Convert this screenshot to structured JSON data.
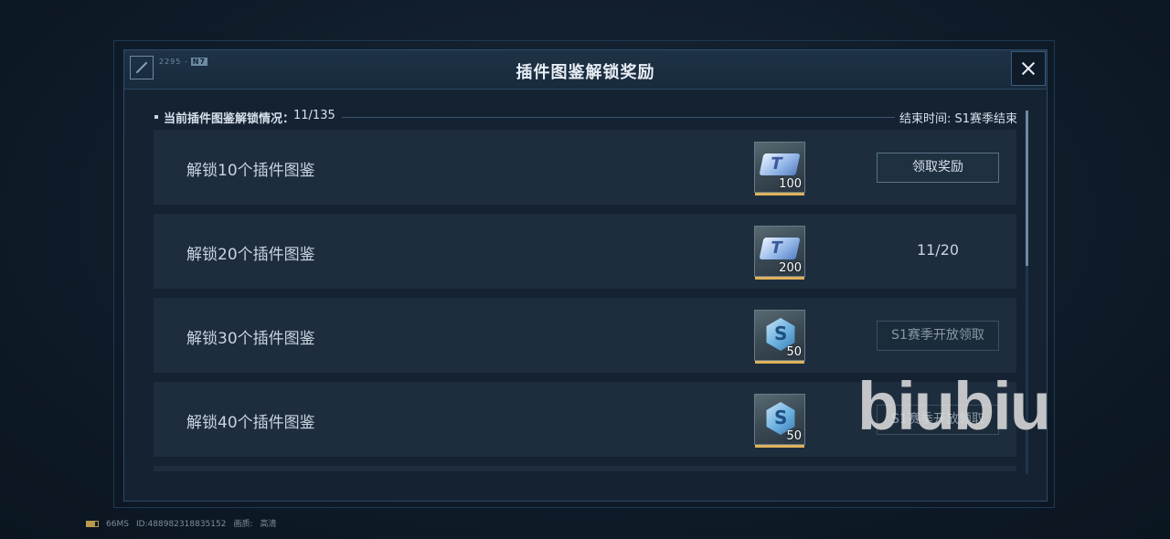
{
  "dialog": {
    "title": "插件图鉴解锁奖励",
    "logo_text": "2295 -",
    "logo_tag": "N7",
    "close_icon": "close-icon"
  },
  "info": {
    "progress_label": "当前插件图鉴解锁情况：",
    "progress_value": "11/135",
    "end_time": "结束时间: S1赛季结束"
  },
  "rewards": [
    {
      "title": "解锁10个插件图鉴",
      "icon": "ticket-icon",
      "qty": "100",
      "action": "领取奖励",
      "action_type": "button"
    },
    {
      "title": "解锁20个插件图鉴",
      "icon": "ticket-icon",
      "qty": "200",
      "action": "11/20",
      "action_type": "status"
    },
    {
      "title": "解锁30个插件图鉴",
      "icon": "hex-emblem-icon",
      "qty": "50",
      "action": "S1赛季开放领取",
      "action_type": "disabled"
    },
    {
      "title": "解锁40个插件图鉴",
      "icon": "hex-emblem-icon",
      "qty": "50",
      "action": "S1赛季开放领取",
      "action_type": "disabled"
    }
  ],
  "watermark": "biubiu",
  "footer": {
    "latency": "66MS",
    "user_id": "ID:488982318835152",
    "quality_label": "画质:",
    "quality_value": "高清"
  }
}
